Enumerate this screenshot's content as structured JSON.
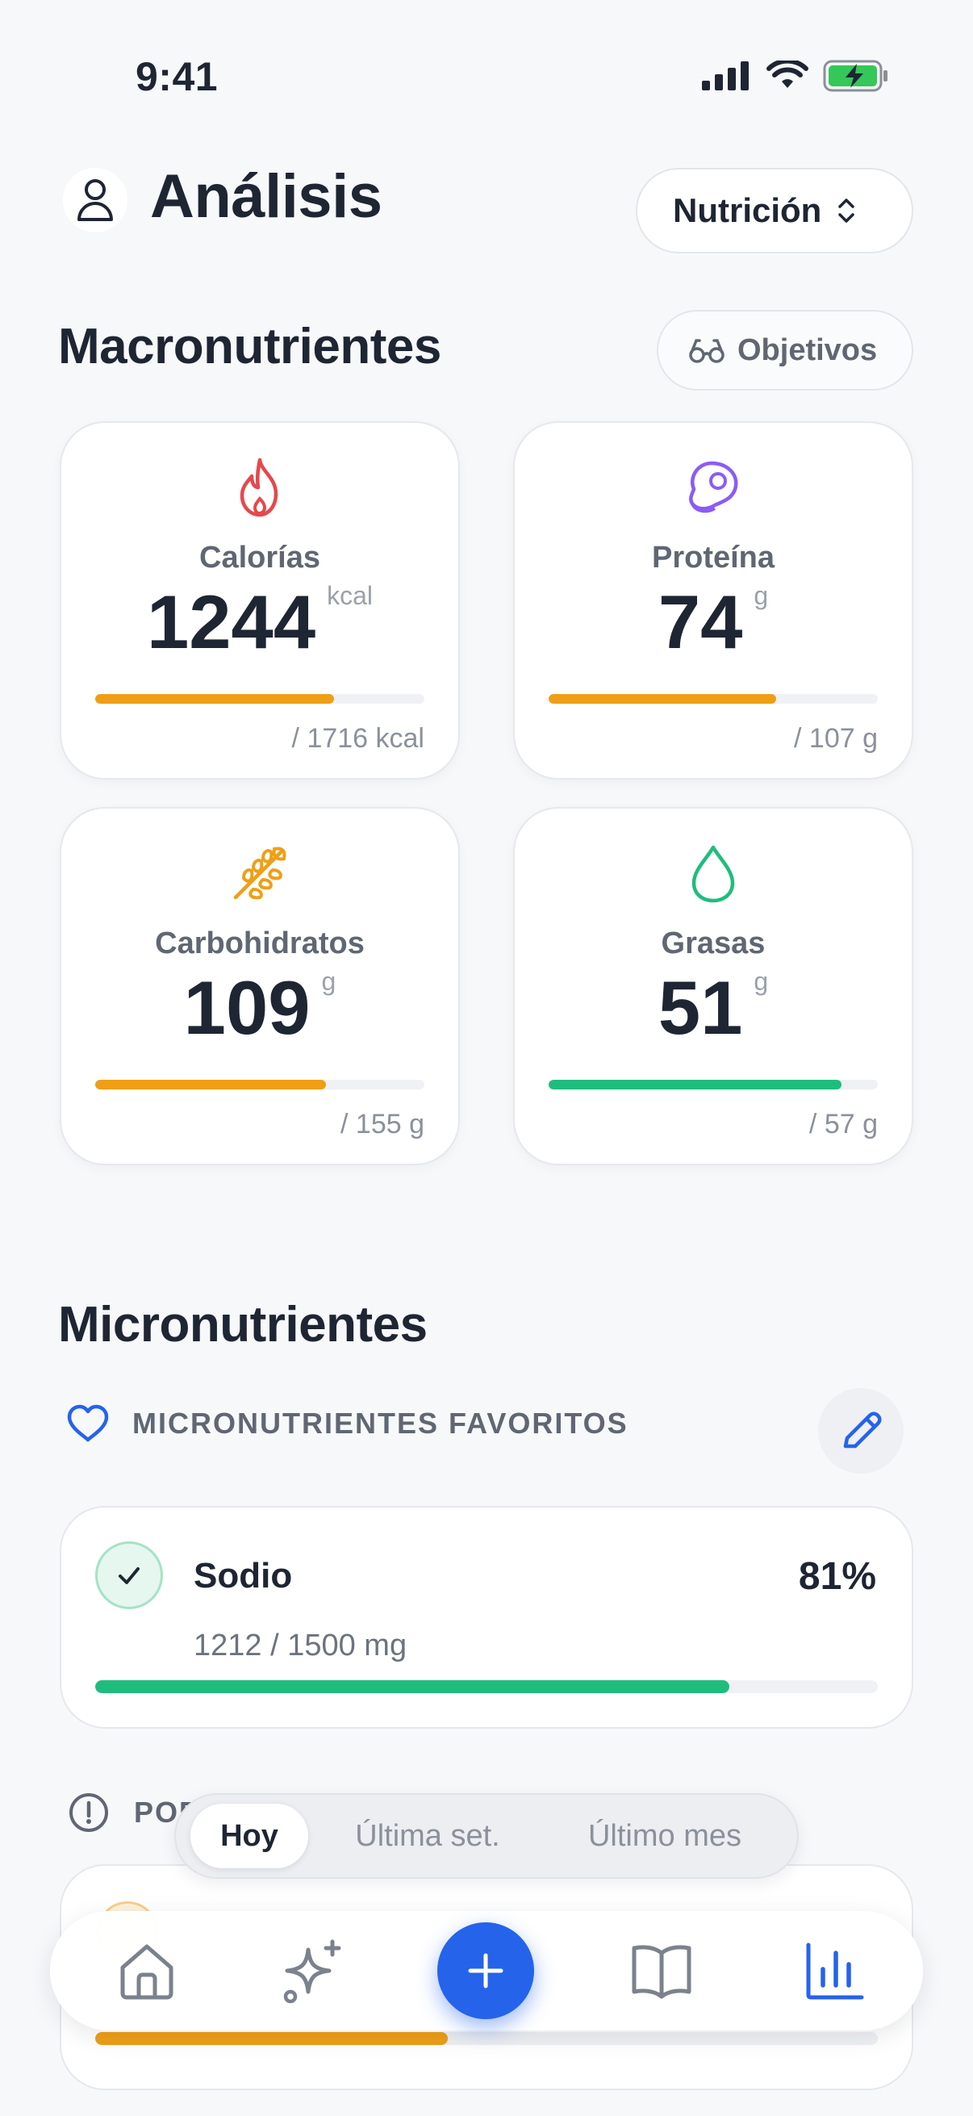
{
  "status_bar": {
    "time": "9:41"
  },
  "header": {
    "title": "Análisis",
    "mode_select": "Nutrición"
  },
  "macros": {
    "title": "Macronutrientes",
    "goals_button": "Objetivos",
    "cards": [
      {
        "label": "Calorías",
        "value": "1244",
        "unit": "kcal",
        "goal": "/ 1716 kcal",
        "progress": 0.725,
        "color": "#ef9f16",
        "icon": "flame-icon"
      },
      {
        "label": "Proteína",
        "value": "74",
        "unit": "g",
        "goal": "/ 107 g",
        "progress": 0.69,
        "color": "#ef9f16",
        "icon": "steak-icon"
      },
      {
        "label": "Carbohidratos",
        "value": "109",
        "unit": "g",
        "goal": "/ 155 g",
        "progress": 0.7,
        "color": "#ef9f16",
        "icon": "wheat-icon"
      },
      {
        "label": "Grasas",
        "value": "51",
        "unit": "g",
        "goal": "/ 57 g",
        "progress": 0.89,
        "color": "#1fbd7d",
        "icon": "droplet-icon"
      }
    ]
  },
  "micros": {
    "title": "Micronutrientes",
    "favorites_title": "MICRONUTRIENTES FAVORITOS",
    "items": [
      {
        "name": "Sodio",
        "percent": "81%",
        "amount": "1212 / 1500 mg",
        "progress": 0.81
      }
    ],
    "warning_title": "POR",
    "second_item_progress": 0.45
  },
  "period_switch": {
    "options": [
      "Hoy",
      "Última set.",
      "Último mes"
    ],
    "selected": "Hoy"
  },
  "tab_bar": {
    "items": [
      "home-icon",
      "sparkles-icon",
      "add-icon",
      "book-icon",
      "chart-icon"
    ],
    "active": "chart-icon"
  },
  "colors": {
    "accent": "#2563eb",
    "orange": "#ef9f16",
    "green": "#1fbd7d",
    "red": "#e5484d",
    "purple": "#8b5cf6"
  }
}
